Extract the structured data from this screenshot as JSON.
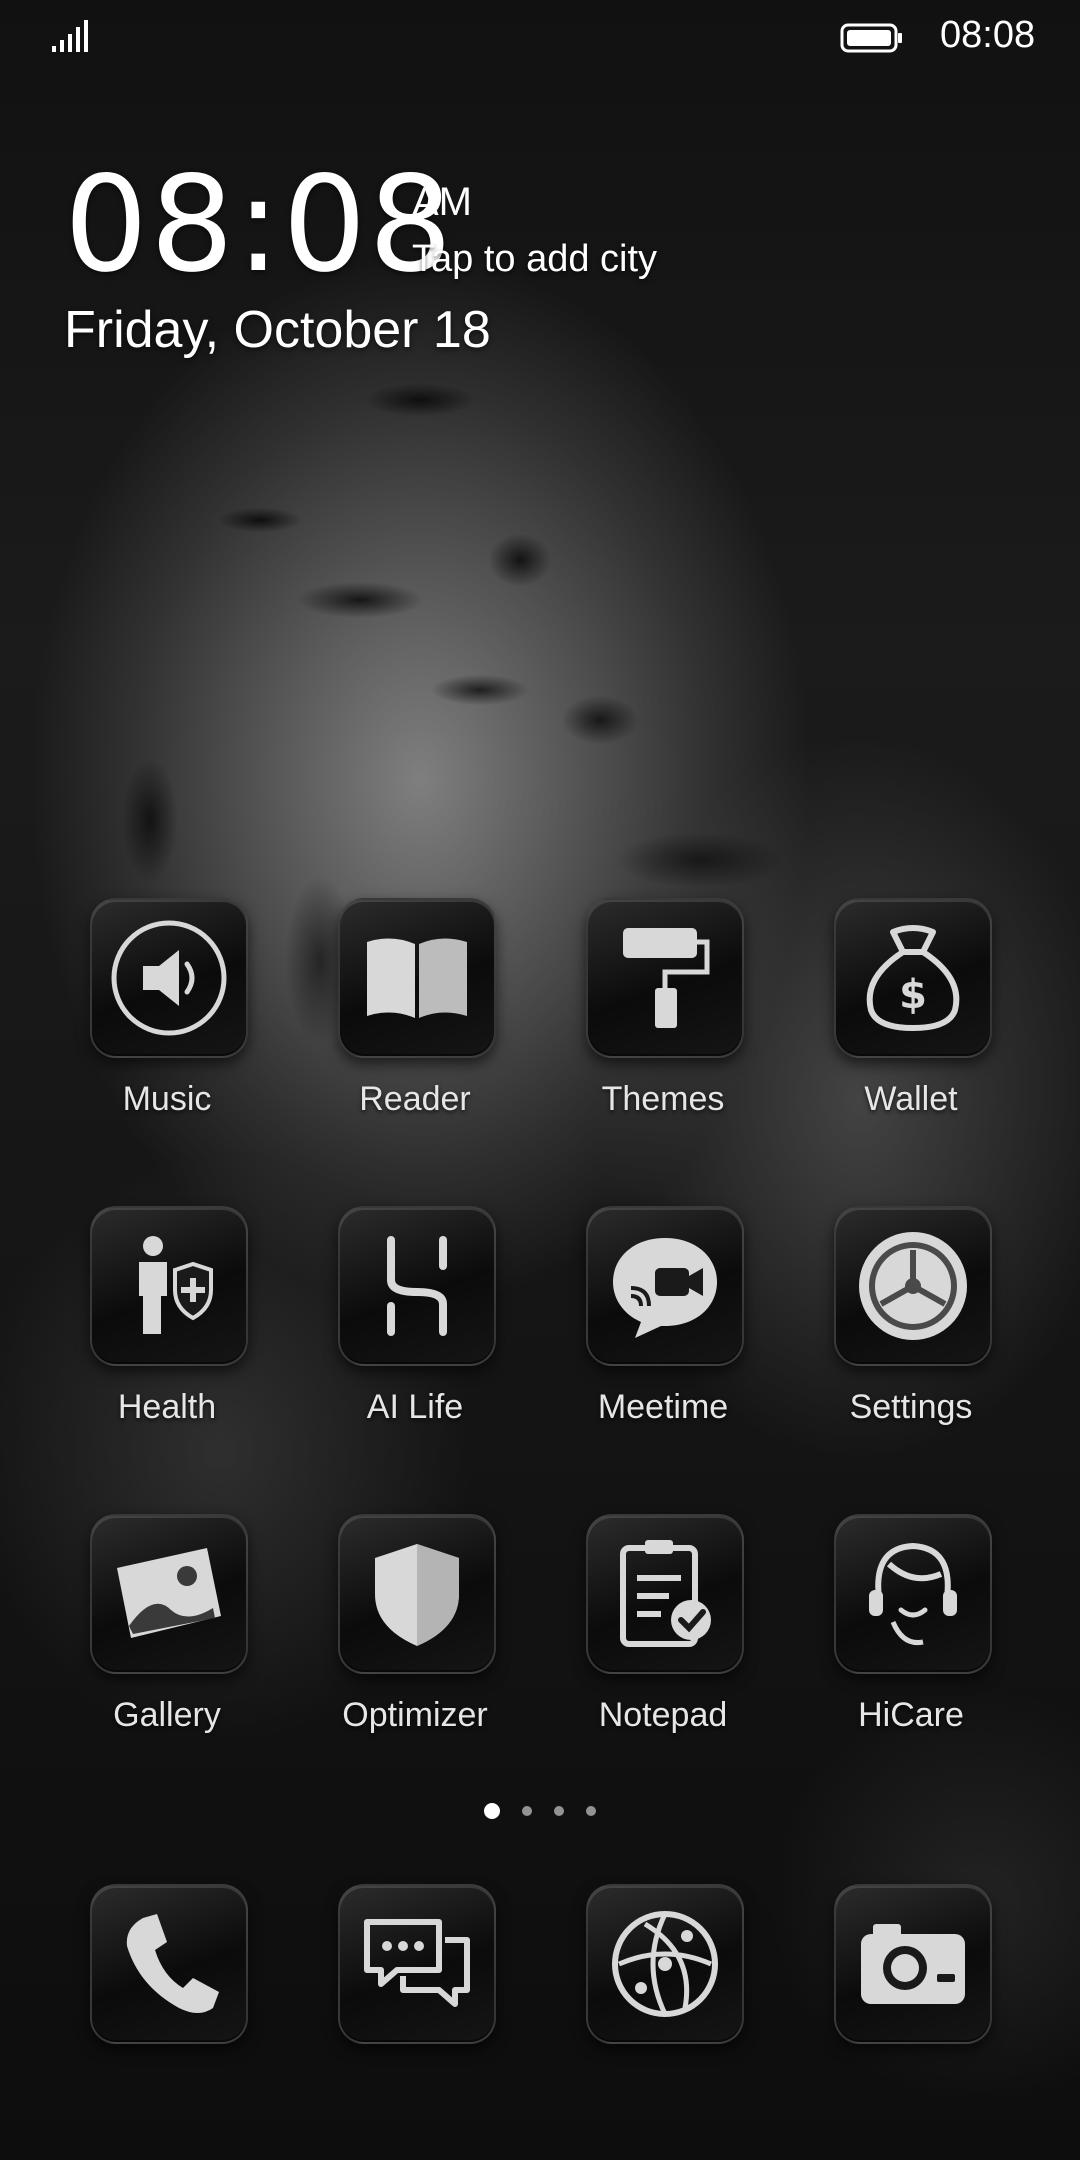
{
  "status_bar": {
    "time": "08:08",
    "signal_icon": "signal-bars-icon",
    "battery_icon": "battery-icon"
  },
  "clock_widget": {
    "time": "08:08",
    "ampm": "AM",
    "city_prompt": "Tap to add city",
    "date": "Friday, October 18"
  },
  "apps": {
    "row1": [
      {
        "label": "Music",
        "icon": "speaker-icon"
      },
      {
        "label": "Reader",
        "icon": "book-icon"
      },
      {
        "label": "Themes",
        "icon": "paint-roller-icon"
      },
      {
        "label": "Wallet",
        "icon": "money-bag-icon"
      }
    ],
    "row2": [
      {
        "label": "Health",
        "icon": "health-person-icon"
      },
      {
        "label": "AI Life",
        "icon": "ai-life-icon"
      },
      {
        "label": "Meetime",
        "icon": "video-chat-icon"
      },
      {
        "label": "Settings",
        "icon": "gear-icon"
      }
    ],
    "row3": [
      {
        "label": "Gallery",
        "icon": "photo-icon"
      },
      {
        "label": "Optimizer",
        "icon": "shield-icon"
      },
      {
        "label": "Notepad",
        "icon": "notepad-icon"
      },
      {
        "label": "HiCare",
        "icon": "headset-icon"
      }
    ]
  },
  "page_indicator": {
    "pages": 4,
    "current": 1
  },
  "dock": [
    {
      "icon": "phone-icon"
    },
    {
      "icon": "messages-icon"
    },
    {
      "icon": "browser-icon"
    },
    {
      "icon": "camera-icon"
    }
  ],
  "colors": {
    "icon_fill": "#d8d8d8",
    "text": "#f2f2f2"
  }
}
